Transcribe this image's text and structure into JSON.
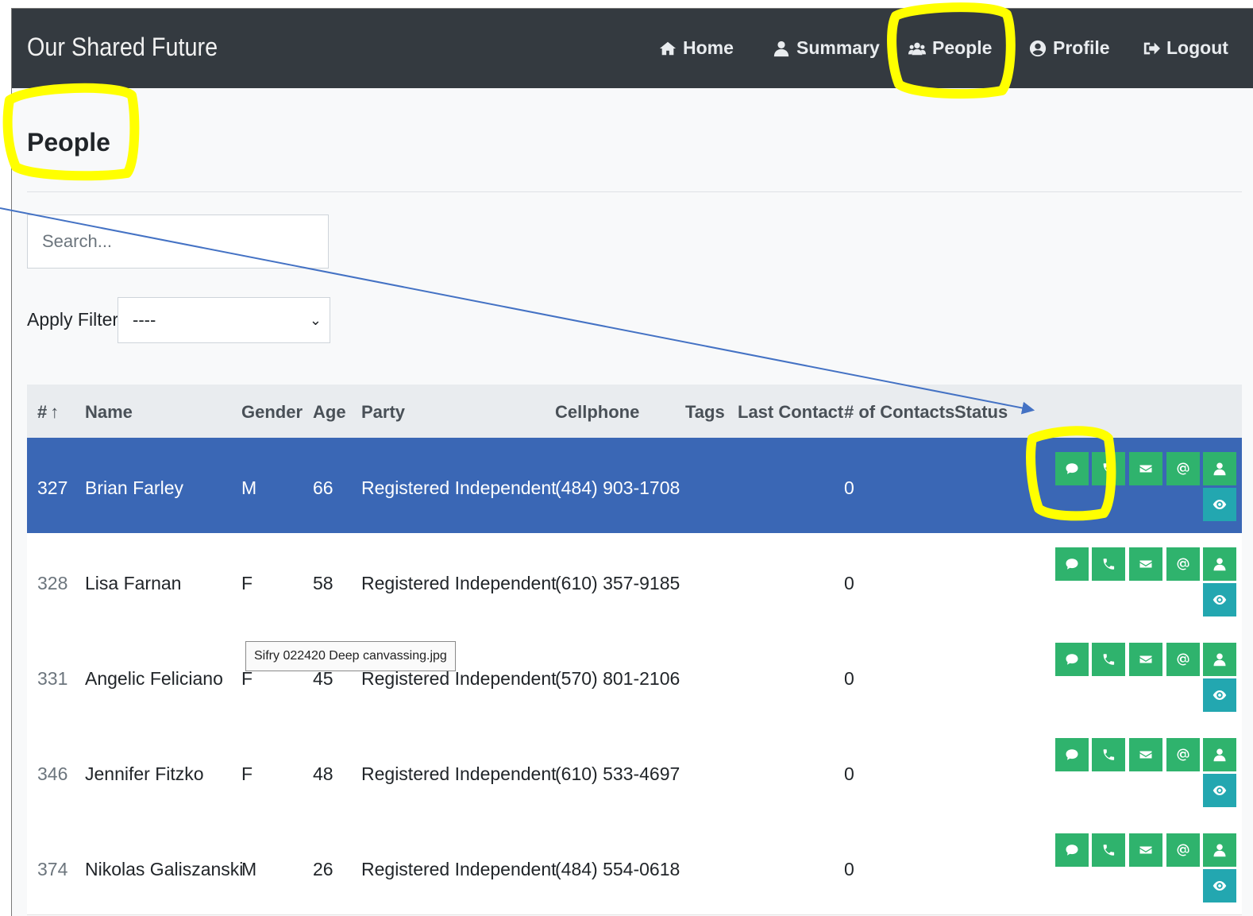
{
  "navbar": {
    "brand": "Our Shared Future",
    "items": [
      {
        "label": "Home",
        "icon": "home-icon"
      },
      {
        "label": "Summary",
        "icon": "user-icon"
      },
      {
        "label": "People",
        "icon": "users-icon"
      },
      {
        "label": "Profile",
        "icon": "user-circle-icon"
      },
      {
        "label": "Logout",
        "icon": "sign-out-icon"
      }
    ]
  },
  "page": {
    "title": "People"
  },
  "search": {
    "placeholder": "Search..."
  },
  "filter": {
    "label": "Apply Filter",
    "selected": "----"
  },
  "table": {
    "columns": [
      "#",
      "Name",
      "Gender",
      "Age",
      "Party",
      "Cellphone",
      "Tags",
      "Last Contact",
      "# of Contacts",
      "Status"
    ],
    "sort_indicator": "↑",
    "rows": [
      {
        "id": "327",
        "name": "Brian Farley",
        "gender": "M",
        "age": "66",
        "party": "Registered Independent",
        "cellphone": "(484) 903-1708",
        "tags": "",
        "last_contact": "",
        "contacts": "0",
        "status": "",
        "selected": true
      },
      {
        "id": "328",
        "name": "Lisa Farnan",
        "gender": "F",
        "age": "58",
        "party": "Registered Independent",
        "cellphone": "(610) 357-9185",
        "tags": "",
        "last_contact": "",
        "contacts": "0",
        "status": ""
      },
      {
        "id": "331",
        "name": "Angelic Feliciano",
        "gender": "F",
        "age": "45",
        "party": "Registered Independent",
        "cellphone": "(570) 801-2106",
        "tags": "",
        "last_contact": "",
        "contacts": "0",
        "status": ""
      },
      {
        "id": "346",
        "name": "Jennifer Fitzko",
        "gender": "F",
        "age": "48",
        "party": "Registered Independent",
        "cellphone": "(610) 533-4697",
        "tags": "",
        "last_contact": "",
        "contacts": "0",
        "status": ""
      },
      {
        "id": "374",
        "name": "Nikolas Galiszanski",
        "gender": "M",
        "age": "26",
        "party": "Registered Independent",
        "cellphone": "(484) 554-0618",
        "tags": "",
        "last_contact": "",
        "contacts": "0",
        "status": ""
      }
    ],
    "row_actions": [
      "sms-icon",
      "phone-icon",
      "envelope-icon",
      "at-icon",
      "user-icon",
      "eye-icon"
    ]
  },
  "tooltip": {
    "text": "Sifry 022420 Deep canvassing.jpg"
  },
  "colors": {
    "navbar": "#343a40",
    "selected_row": "#3a67b5",
    "action_button": "#2fb36d",
    "view_button": "#23a7b0",
    "highlight": "#ffff00",
    "arrow": "#4472c4"
  }
}
